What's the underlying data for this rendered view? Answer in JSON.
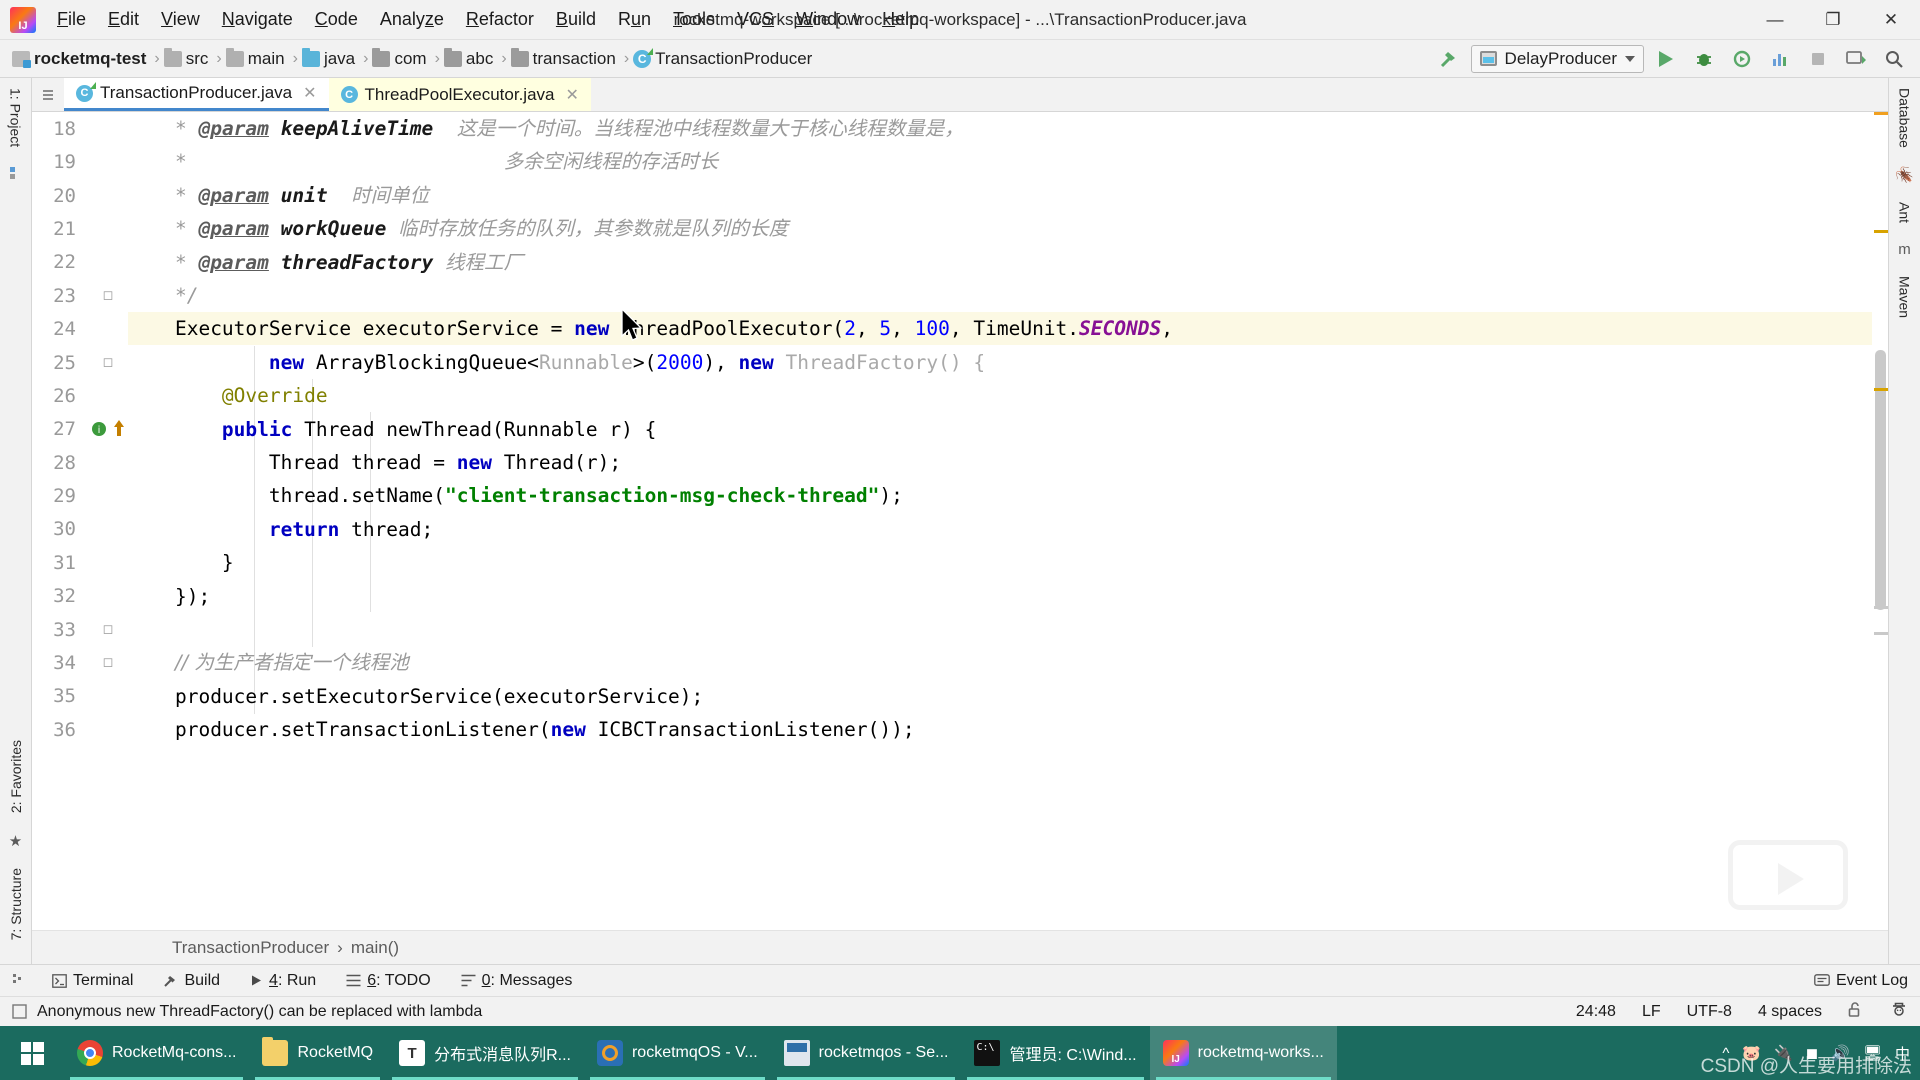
{
  "window": {
    "title": "rocketmq-workspace [...\\rocketmq-workspace] - ...\\TransactionProducer.java",
    "minimize": "—",
    "maximize": "❐",
    "close": "✕"
  },
  "menu": {
    "items": [
      "File",
      "Edit",
      "View",
      "Navigate",
      "Code",
      "Analyze",
      "Refactor",
      "Build",
      "Run",
      "Tools",
      "VCS",
      "Window",
      "Help"
    ]
  },
  "breadcrumb": {
    "separator": "›",
    "items": [
      {
        "label": "rocketmq-test",
        "icon": "module-icon"
      },
      {
        "label": "src",
        "icon": "folder-icon"
      },
      {
        "label": "main",
        "icon": "folder-icon"
      },
      {
        "label": "java",
        "icon": "folder-blue-icon"
      },
      {
        "label": "com",
        "icon": "package-icon"
      },
      {
        "label": "abc",
        "icon": "package-icon"
      },
      {
        "label": "transaction",
        "icon": "package-icon"
      },
      {
        "label": "TransactionProducer",
        "icon": "class-icon"
      }
    ]
  },
  "toolbar": {
    "run_config": "DelayProducer",
    "buttons": [
      "build-hammer",
      "run",
      "debug",
      "run-coverage",
      "profile",
      "stop",
      "update-app",
      "search-everywhere"
    ]
  },
  "editor_tabs": [
    {
      "label": "TransactionProducer.java",
      "active": true,
      "close": "✕"
    },
    {
      "label": "ThreadPoolExecutor.java",
      "active": false,
      "close": "✕"
    }
  ],
  "left_tool_tabs": [
    {
      "label": "1: Project"
    },
    {
      "label": "2: Favorites"
    },
    {
      "label": "7: Structure"
    }
  ],
  "right_tool_tabs": [
    {
      "label": "Database"
    },
    {
      "label": "Ant"
    },
    {
      "label": "Maven"
    }
  ],
  "code": {
    "first_line": 18,
    "highlight_line": 24,
    "lines": [
      {
        "n": 18,
        "indent": 0
      },
      {
        "n": 19,
        "indent": 0
      },
      {
        "n": 20,
        "indent": 0
      },
      {
        "n": 21,
        "indent": 0
      },
      {
        "n": 22,
        "indent": 0
      },
      {
        "n": 23,
        "indent": 0
      },
      {
        "n": 24,
        "indent": 0
      },
      {
        "n": 25,
        "indent": 0
      },
      {
        "n": 26,
        "indent": 0
      },
      {
        "n": 27,
        "indent": 0
      },
      {
        "n": 28,
        "indent": 0
      },
      {
        "n": 29,
        "indent": 0
      },
      {
        "n": 30,
        "indent": 0
      },
      {
        "n": 31,
        "indent": 0
      },
      {
        "n": 32,
        "indent": 0
      },
      {
        "n": 33,
        "indent": 0
      },
      {
        "n": 34,
        "indent": 0
      },
      {
        "n": 35,
        "indent": 0
      },
      {
        "n": 36,
        "indent": 0
      }
    ],
    "text": {
      "l18_star": "*",
      "l18_tag": "@param",
      "l18_param": "keepAliveTime",
      "l18_desc": "这是一个时间。当线程池中线程数量大于核心线程数量是，",
      "l19_star": "*",
      "l19_desc": "多余空闲线程的存活时长",
      "l20_tag": "@param",
      "l20_param": "unit",
      "l20_desc": "时间单位",
      "l21_tag": "@param",
      "l21_param": "workQueue",
      "l21_desc": "临时存放任务的队列，其参数就是队列的长度",
      "l22_tag": "@param",
      "l22_param": "threadFactory",
      "l22_desc": "线程工厂",
      "l23": "*/",
      "l24_a": "ExecutorService executorService = ",
      "l24_new": "new",
      "l24_b": " ThreadPoolExecutor(",
      "l24_n1": "2",
      "l24_c": ", ",
      "l24_n2": "5",
      "l24_d": ", ",
      "l24_n3": "100",
      "l24_e": ", TimeUnit.",
      "l24_const": "SECONDS",
      "l24_f": ",",
      "l25_new1": "new",
      "l25_a": " ArrayBlockingQueue<",
      "l25_gen": "Runnable",
      "l25_b": ">(",
      "l25_n": "2000",
      "l25_c": "), ",
      "l25_new2": "new",
      "l25_d": " ",
      "l25_tf": "ThreadFactory() {",
      "l26": "@Override",
      "l27_pub": "public",
      "l27_rest": " Thread newThread(Runnable r) {",
      "l28_a": "Thread thread = ",
      "l28_new": "new",
      "l28_b": " Thread(r);",
      "l29_a": "thread.setName(",
      "l29_str": "\"client-transaction-msg-check-thread\"",
      "l29_b": ");",
      "l30_ret": "return",
      "l30_rest": " thread;",
      "l31": "}",
      "l32": "});",
      "l34_comment": "// 为生产者指定一个线程池",
      "l35": "producer.setExecutorService(executorService);",
      "l36_a": "producer.setTransactionListener(",
      "l36_new": "new",
      "l36_b": " ICBCTransactionListener());"
    }
  },
  "editor_breadcrumb": {
    "separator": "›",
    "items": [
      "TransactionProducer",
      "main()"
    ]
  },
  "tool_window_bar": {
    "items": [
      {
        "label": "Terminal",
        "icon": "terminal-icon",
        "mnemonic": ""
      },
      {
        "label": "Build",
        "icon": "hammer-icon",
        "mnemonic": ""
      },
      {
        "label": "4: Run",
        "icon": "play-icon",
        "mnemonic": "4"
      },
      {
        "label": "6: TODO",
        "icon": "list-icon",
        "mnemonic": "6"
      },
      {
        "label": "0: Messages",
        "icon": "messages-icon",
        "mnemonic": "0"
      }
    ],
    "event_log": "Event Log"
  },
  "status_bar": {
    "message": "Anonymous new ThreadFactory() can be replaced with lambda",
    "position": "24:48",
    "line_separator": "LF",
    "encoding": "UTF-8",
    "indent": "4 spaces",
    "lock_icon": "unlocked-icon",
    "hat_icon": "hectorthe-inspector-icon"
  },
  "taskbar": {
    "start": "windows-start-icon",
    "items": [
      {
        "label": "RocketMq-cons...",
        "icon": "chrome-icon",
        "active": false
      },
      {
        "label": "RocketMQ",
        "icon": "folder-icon",
        "active": false
      },
      {
        "label": "分布式消息队列R...",
        "icon": "typora-icon",
        "active": false
      },
      {
        "label": "rocketmqOS - V...",
        "icon": "virtualbox-icon",
        "active": false
      },
      {
        "label": "rocketmqos - Se...",
        "icon": "securecrt-icon",
        "active": false
      },
      {
        "label": "管理员: C:\\Wind...",
        "icon": "cmd-icon",
        "active": false
      },
      {
        "label": "rocketmq-works...",
        "icon": "intellij-icon",
        "active": true
      }
    ],
    "watermark": "CSDN @人生要用排除法",
    "tray": [
      "⌃",
      "🐷",
      "🔌",
      "◴",
      "🔊",
      "🖥",
      "中"
    ]
  },
  "colors": {
    "accent_blue": "#4387cc",
    "keyword": "#0000c0",
    "string": "#008000",
    "number": "#0000ff",
    "comment": "#9a9a9a",
    "annotation": "#808000",
    "constant": "#871094",
    "highlight_row": "#fcf9e4",
    "taskbar_bg": "#1b6b5f"
  }
}
